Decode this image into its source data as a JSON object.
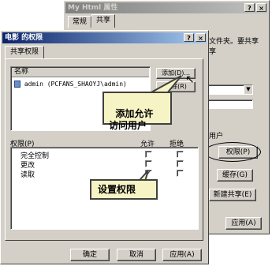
{
  "back_window": {
    "title": "My Html 属性",
    "tabs": [
      "常规",
      "共享"
    ],
    "text_fragment": "文件夹。要共享",
    "text_fragment2": "享",
    "user_fragment": "用户",
    "permissions_button": "权限(P)",
    "cache_button": "缓存(G)",
    "new_share_button": "新建共享(E)",
    "apply_button": "应用(A)",
    "help_glyph": "?",
    "close_glyph": "×"
  },
  "front_window": {
    "title": "电影 的权限",
    "tab": "共享权限",
    "list_header": "名称",
    "users": [
      "admin (PCFANS_SHAOYJ\\admin)"
    ],
    "add_button": "添加(D)...",
    "remove_button": "删除(R)",
    "permissions_label": "权限(P)",
    "allow_header": "允许",
    "deny_header": "拒绝",
    "permissions": [
      {
        "name": "完全控制",
        "allow": false,
        "deny": false
      },
      {
        "name": "更改",
        "allow": false,
        "deny": false
      },
      {
        "name": "读取",
        "allow": true,
        "deny": false
      }
    ],
    "ok_button": "确定",
    "cancel_button": "取消",
    "apply_button": "应用(A)",
    "help_glyph": "?",
    "close_glyph": "×"
  },
  "callouts": {
    "add_user": "添加允许\n访问用户",
    "set_permission": "设置权限"
  }
}
